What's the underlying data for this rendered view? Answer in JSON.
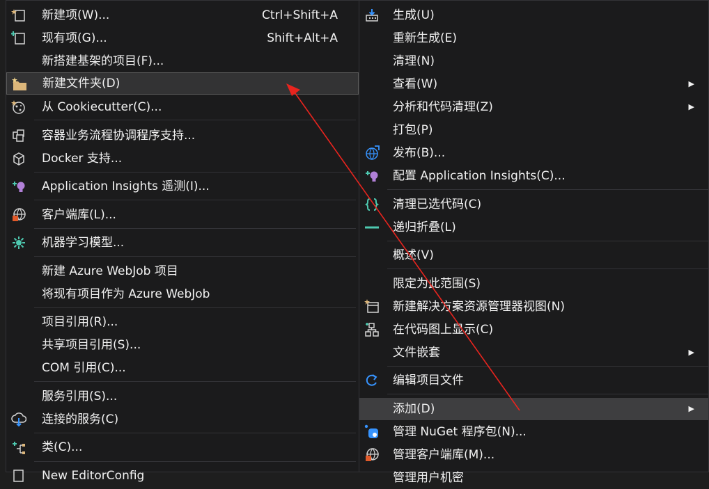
{
  "submenu": {
    "items": [
      {
        "label": "新建项(W)...",
        "shortcut": "Ctrl+Shift+A",
        "icon": "new-item-icon"
      },
      {
        "label": "现有项(G)...",
        "shortcut": "Shift+Alt+A",
        "icon": "existing-item-icon"
      },
      {
        "label": "新搭建基架的项目(F)...",
        "shortcut": "",
        "icon": ""
      },
      {
        "label": "新建文件夹(D)",
        "shortcut": "",
        "icon": "new-folder-icon"
      },
      {
        "label": "从 Cookiecutter(C)...",
        "shortcut": "",
        "icon": "cookiecutter-icon"
      },
      {
        "label": "容器业务流程协调程序支持...",
        "shortcut": "",
        "icon": "container-orchestration-icon"
      },
      {
        "label": "Docker 支持...",
        "shortcut": "",
        "icon": "docker-icon"
      },
      {
        "label": "Application Insights 遥测(I)...",
        "shortcut": "",
        "icon": "application-insights-icon"
      },
      {
        "label": "客户端库(L)...",
        "shortcut": "",
        "icon": "client-library-icon"
      },
      {
        "label": "机器学习模型...",
        "shortcut": "",
        "icon": "machine-learning-icon"
      },
      {
        "label": "新建 Azure WebJob 项目",
        "shortcut": "",
        "icon": ""
      },
      {
        "label": "将现有项目作为 Azure WebJob",
        "shortcut": "",
        "icon": ""
      },
      {
        "label": "项目引用(R)...",
        "shortcut": "",
        "icon": ""
      },
      {
        "label": "共享项目引用(S)...",
        "shortcut": "",
        "icon": ""
      },
      {
        "label": "COM 引用(C)...",
        "shortcut": "",
        "icon": ""
      },
      {
        "label": "服务引用(S)...",
        "shortcut": "",
        "icon": ""
      },
      {
        "label": "连接的服务(C)",
        "shortcut": "",
        "icon": "connected-service-icon"
      },
      {
        "label": "类(C)...",
        "shortcut": "",
        "icon": "class-icon"
      },
      {
        "label": "New EditorConfig",
        "shortcut": "",
        "icon": "editorconfig-icon"
      }
    ]
  },
  "context_menu": {
    "items": [
      {
        "label": "生成(U)",
        "icon": "build-icon"
      },
      {
        "label": "重新生成(E)",
        "icon": ""
      },
      {
        "label": "清理(N)",
        "icon": ""
      },
      {
        "label": "查看(W)",
        "icon": ""
      },
      {
        "label": "分析和代码清理(Z)",
        "icon": ""
      },
      {
        "label": "打包(P)",
        "icon": ""
      },
      {
        "label": "发布(B)...",
        "icon": "publish-icon"
      },
      {
        "label": "配置 Application Insights(C)...",
        "icon": "application-insights-icon"
      },
      {
        "label": "清理已选代码(C)",
        "icon": "code-cleanup-icon"
      },
      {
        "label": "递归折叠(L)",
        "icon": "collapse-icon"
      },
      {
        "label": "概述(V)",
        "icon": ""
      },
      {
        "label": "限定为此范围(S)",
        "icon": ""
      },
      {
        "label": "新建解决方案资源管理器视图(N)",
        "icon": "new-view-icon"
      },
      {
        "label": "在代码图上显示(C)",
        "icon": "code-map-icon"
      },
      {
        "label": "文件嵌套",
        "icon": ""
      },
      {
        "label": "编辑项目文件",
        "icon": "edit-project-icon"
      },
      {
        "label": "添加(D)",
        "icon": ""
      },
      {
        "label": "管理 NuGet 程序包(N)...",
        "icon": "nuget-icon"
      },
      {
        "label": "管理客户端库(M)...",
        "icon": "client-library-icon"
      },
      {
        "label": "管理用户机密",
        "icon": ""
      }
    ],
    "submenu_arrow": "▶"
  },
  "colors": {
    "menu_bg": "#1b1b1c",
    "highlight_bg": "#333334",
    "text": "#f1f1f1",
    "arrow": "#e8241e",
    "folder": "#dcb67a",
    "purple": "#b180d7",
    "teal": "#4ec9b0",
    "blue": "#3794ff"
  }
}
